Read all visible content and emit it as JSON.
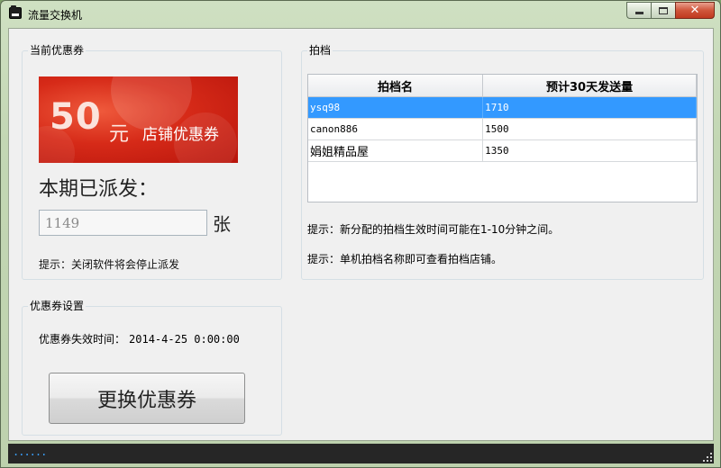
{
  "window": {
    "title": "流量交换机",
    "buttons": {
      "minimize_icon": "minimize-icon",
      "maximize_icon": "maximize-icon",
      "close_label": "✕"
    }
  },
  "coupon": {
    "group_title": "当前优惠券",
    "banner": {
      "amount": "50",
      "unit": "元",
      "label": "店铺优惠券"
    },
    "dispatched_label": "本期已派发：",
    "dispatched_count": "1149",
    "count_unit": "张",
    "hint": "提示：关闭软件将会停止派发"
  },
  "partner": {
    "group_title": "拍档",
    "table": {
      "headers": [
        "拍档名",
        "预计30天发送量"
      ],
      "rows": [
        {
          "name": "ysq98",
          "volume": "1710",
          "selected": true
        },
        {
          "name": "canon886",
          "volume": "1500",
          "selected": false
        },
        {
          "name": "娟姐精品屋",
          "volume": "1350",
          "selected": false
        }
      ]
    },
    "hint1": "提示：新分配的拍档生效时间可能在1-10分钟之间。",
    "hint2": "提示：单机拍档名称即可查看拍档店铺。"
  },
  "settings": {
    "group_title": "优惠券设置",
    "expire_label": "优惠券失效时间：",
    "expire_value": "2014-4-25 0:00:00",
    "swap_button": "更换优惠券"
  },
  "status": {
    "text": "......"
  },
  "colors": {
    "selected_row": "#3399ff",
    "banner_red": "#d62a18",
    "status_text": "#3aa0ff"
  }
}
